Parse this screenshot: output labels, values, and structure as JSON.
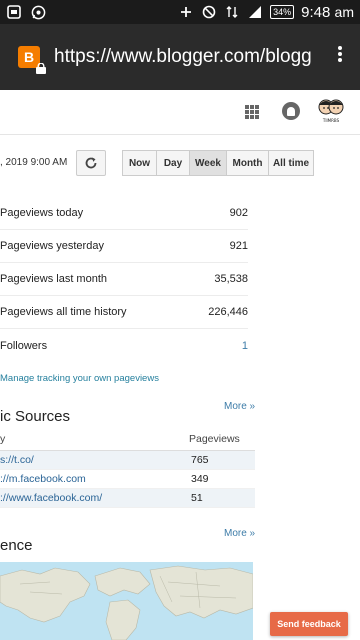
{
  "status_bar": {
    "battery": "34%",
    "time": "9:48",
    "ampm": "am",
    "icons": [
      "notification-icon",
      "whatsapp-icon",
      "plus-icon",
      "dnd-icon",
      "data-icon",
      "signal-icon"
    ]
  },
  "browser": {
    "url": "https://www.blogger.com/blogg",
    "favicon_letter": "B"
  },
  "header": {
    "apps_icon": "apps-grid-icon",
    "notifications_icon": "notification-bell-icon",
    "avatar_label": "TIIMRBS"
  },
  "controls": {
    "date_text": ", 2019 9:00 AM",
    "periods": [
      {
        "label": "Now",
        "active": false
      },
      {
        "label": "Day",
        "active": false
      },
      {
        "label": "Week",
        "active": true
      },
      {
        "label": "Month",
        "active": false
      },
      {
        "label": "All time",
        "active": false
      }
    ]
  },
  "stats": [
    {
      "label": "Pageviews today",
      "value": "902"
    },
    {
      "label": "Pageviews yesterday",
      "value": "921"
    },
    {
      "label": "Pageviews last month",
      "value": "35,538"
    },
    {
      "label": "Pageviews all time history",
      "value": "226,446"
    },
    {
      "label": "Followers",
      "value": "1"
    }
  ],
  "manage_link": "Manage tracking your own pageviews",
  "traffic": {
    "title": "ic Sources",
    "more": "More »",
    "col_source": "y",
    "col_pageviews": "Pageviews",
    "rows": [
      {
        "source": "s://t.co/",
        "views": "765"
      },
      {
        "source": "://m.facebook.com",
        "views": "349"
      },
      {
        "source": "://www.facebook.com/",
        "views": "51"
      }
    ]
  },
  "audience": {
    "title": "ence",
    "more": "More »"
  },
  "feedback_button": "Send feedback",
  "colors": {
    "link": "#3d7ca8",
    "feedback": "#e76a47",
    "blogger": "#f57d00"
  }
}
